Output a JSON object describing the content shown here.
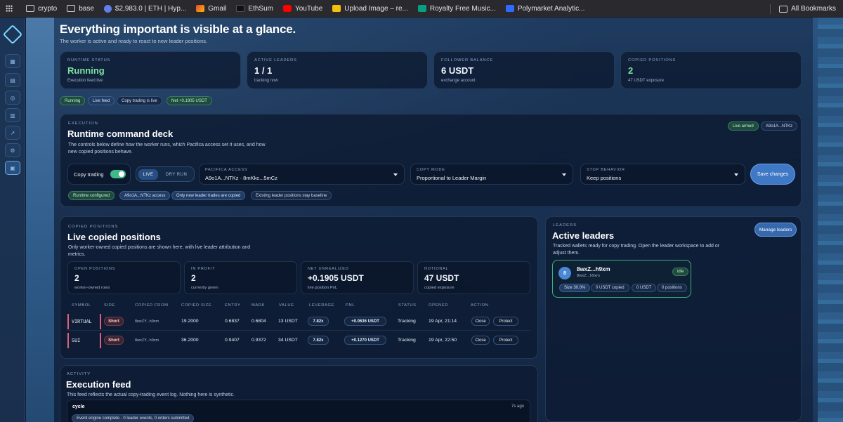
{
  "bookmarks": {
    "items": [
      {
        "label": "crypto",
        "icon": "folder-icon"
      },
      {
        "label": "base",
        "icon": "folder-icon"
      },
      {
        "label": "$2,983.0 | ETH | Hyp...",
        "icon": "eth-icon"
      },
      {
        "label": "Gmail",
        "icon": "gmail-icon"
      },
      {
        "label": "EthSum",
        "icon": "ethsum-icon"
      },
      {
        "label": "YouTube",
        "icon": "youtube-icon"
      },
      {
        "label": "Upload Image – re...",
        "icon": "upload-icon"
      },
      {
        "label": "Royalty Free Music...",
        "icon": "pixabay-icon"
      },
      {
        "label": "Polymarket Analytic...",
        "icon": "polymarket-icon"
      }
    ],
    "all_bookmarks": "All Bookmarks"
  },
  "header": {
    "title": "Everything important is visible at a glance.",
    "subtitle": "The worker is active and ready to react to new leader positions."
  },
  "stats": [
    {
      "label": "RUNTIME STATUS",
      "value": "Running",
      "note": "Execution feed live"
    },
    {
      "label": "ACTIVE LEADERS",
      "value": "1 / 1",
      "note": "tracking now"
    },
    {
      "label": "FOLLOWER BALANCE",
      "value": "6 USDT",
      "note": "exchange account"
    },
    {
      "label": "COPIED POSITIONS",
      "value": "2",
      "note": "47 USDT exposure"
    }
  ],
  "status_pills": [
    "Running",
    "Live feed",
    "Copy trading is live",
    "Net +0.1905 USDT"
  ],
  "execution": {
    "label": "EXECUTION",
    "title": "Runtime command deck",
    "description_line1": "The controls below define how the worker runs, which Pacifica access set it uses, and how",
    "description_line2": "new copied positions behave.",
    "badges": [
      "Live armed",
      "A9o1A...NTKz"
    ],
    "copy_trading_label": "Copy trading",
    "mode_live": "LIVE",
    "mode_dry": "DRY RUN",
    "pacifica_label": "PACIFICA ACCESS",
    "pacifica_value": "A9o1A...NTKz · 8mKkc...5mCz",
    "copy_mode_label": "COPY MODE",
    "copy_mode_value": "Proportional to Leader Margin",
    "stop_label": "STOP BEHAVIOR",
    "stop_value": "Keep positions",
    "save_label": "Save changes",
    "chips": [
      "Runtime configured",
      "A9o1A...NTKz access",
      "Only new leader trades are copied",
      "Existing leader positions stay baseline"
    ]
  },
  "positions": {
    "label": "COPIED POSITIONS",
    "title": "Live copied positions",
    "description_line1": "Only worker-owned copied positions are shown here, with live leader attribution and",
    "description_line2": "metrics.",
    "metrics": [
      {
        "label": "OPEN POSITIONS",
        "value": "2",
        "note": "worker-owned rows"
      },
      {
        "label": "IN PROFIT",
        "value": "2",
        "note": "currently green"
      },
      {
        "label": "NET UNREALIZED",
        "value": "+0.1905 USDT",
        "note": "live position PnL"
      },
      {
        "label": "NOTIONAL",
        "value": "47 USDT",
        "note": "copied exposure"
      }
    ],
    "columns": [
      "SYMBOL",
      "SIDE",
      "COPIED FROM",
      "COPIED SIZE",
      "ENTRY",
      "MARK",
      "VALUE",
      "LEVERAGE",
      "PNL",
      "STATUS",
      "OPENED",
      "ACTION"
    ],
    "rows": [
      {
        "symbol": "VIRTUAL",
        "side": "Short",
        "from": "8wxZY...h9xm",
        "size": "19.2000",
        "entry": "0.6837",
        "mark": "0.6804",
        "value": "13 USDT",
        "leverage": "7.82x",
        "pnl": "+0.0636 USDT",
        "status": "Tracking",
        "opened": "19 Apr, 21:14",
        "close": "Close",
        "protect": "Protect"
      },
      {
        "symbol": "SUI",
        "side": "Short",
        "from": "8wxZY...h9xm",
        "size": "36.2000",
        "entry": "0.9407",
        "mark": "0.9372",
        "value": "34 USDT",
        "leverage": "7.82x",
        "pnl": "+0.1270 USDT",
        "status": "Tracking",
        "opened": "19 Apr, 22:50",
        "close": "Close",
        "protect": "Protect"
      }
    ]
  },
  "leaders": {
    "label": "LEADERS",
    "title": "Active leaders",
    "manage_label": "Manage leaders",
    "description_line1": "Tracked wallets ready for copy trading. Open the leader workspace to add or",
    "description_line2": "adjust them.",
    "card": {
      "avatar": "8",
      "name": "8wxZ...h9xm",
      "sub": "8wxZ...h9xm",
      "state": "idle",
      "tags": [
        "Size 30.0%",
        "0 USDT copied",
        "0 USDT",
        "0 positions"
      ]
    }
  },
  "activity": {
    "label": "ACTIVITY",
    "title": "Execution feed",
    "description": "This feed reflects the actual copy-trading event log. Nothing here is synthetic.",
    "event_title": "cycle",
    "event_time": "7s ago",
    "event_chip": "Event engine complete · 0 leader events, 0 orders submitted"
  },
  "colors": {
    "accent": "#3f79c6",
    "green": "#7ee0a2",
    "short": "#e0607a"
  }
}
